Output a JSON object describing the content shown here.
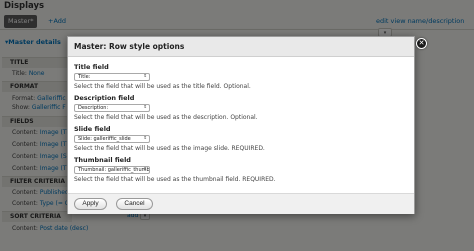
{
  "background": {
    "title": "Displays",
    "tab_master": "Master*",
    "tab_add": "+Add",
    "edit_view": "edit view name/description",
    "details_header": "▾Master details",
    "sections": [
      {
        "head": "TITLE",
        "lines": [
          {
            "label": "Title:",
            "value": "None"
          }
        ]
      },
      {
        "head": "FORMAT",
        "lines": [
          {
            "label": "Format:",
            "value": "Galleriffic G"
          },
          {
            "label": "Show:",
            "value": "Galleriffic F"
          }
        ]
      },
      {
        "head": "FIELDS",
        "lines": [
          {
            "label": "Content:",
            "value": "Image (Title"
          },
          {
            "label": "Content:",
            "value": "Image (Title"
          },
          {
            "label": "Content:",
            "value": "Image (Slide"
          },
          {
            "label": "Content:",
            "value": "Image (Thum"
          }
        ]
      },
      {
        "head": "FILTER CRITERIA",
        "lines": [
          {
            "label": "Content:",
            "value": "Published (Y"
          },
          {
            "label": "Content:",
            "value": "Type (= Gal"
          }
        ]
      },
      {
        "head": "SORT CRITERIA",
        "lines": [
          {
            "label": "Content:",
            "value": "Post date (desc)"
          }
        ]
      }
    ],
    "sort_add": "add"
  },
  "modal": {
    "title": "Master: Row style options",
    "close_glyph": "✕",
    "fields": [
      {
        "label": "Title field",
        "select": "Title:",
        "desc": "Select the field that will be used as the title field. Optional."
      },
      {
        "label": "Description field",
        "select": "Description:",
        "desc": "Select the field that will be used as the description. Optional."
      },
      {
        "label": "Slide field",
        "select": "Slide: galleriffic_slide",
        "desc": "Select the field that will be used as the image slide. REQUIRED."
      },
      {
        "label": "Thumbnail field",
        "select": "Thumbnail: galleriffic_thumb",
        "desc": "Select the field that will be used as the thumbnail field. REQUIRED."
      }
    ],
    "apply_label": "Apply",
    "cancel_label": "Cancel"
  }
}
